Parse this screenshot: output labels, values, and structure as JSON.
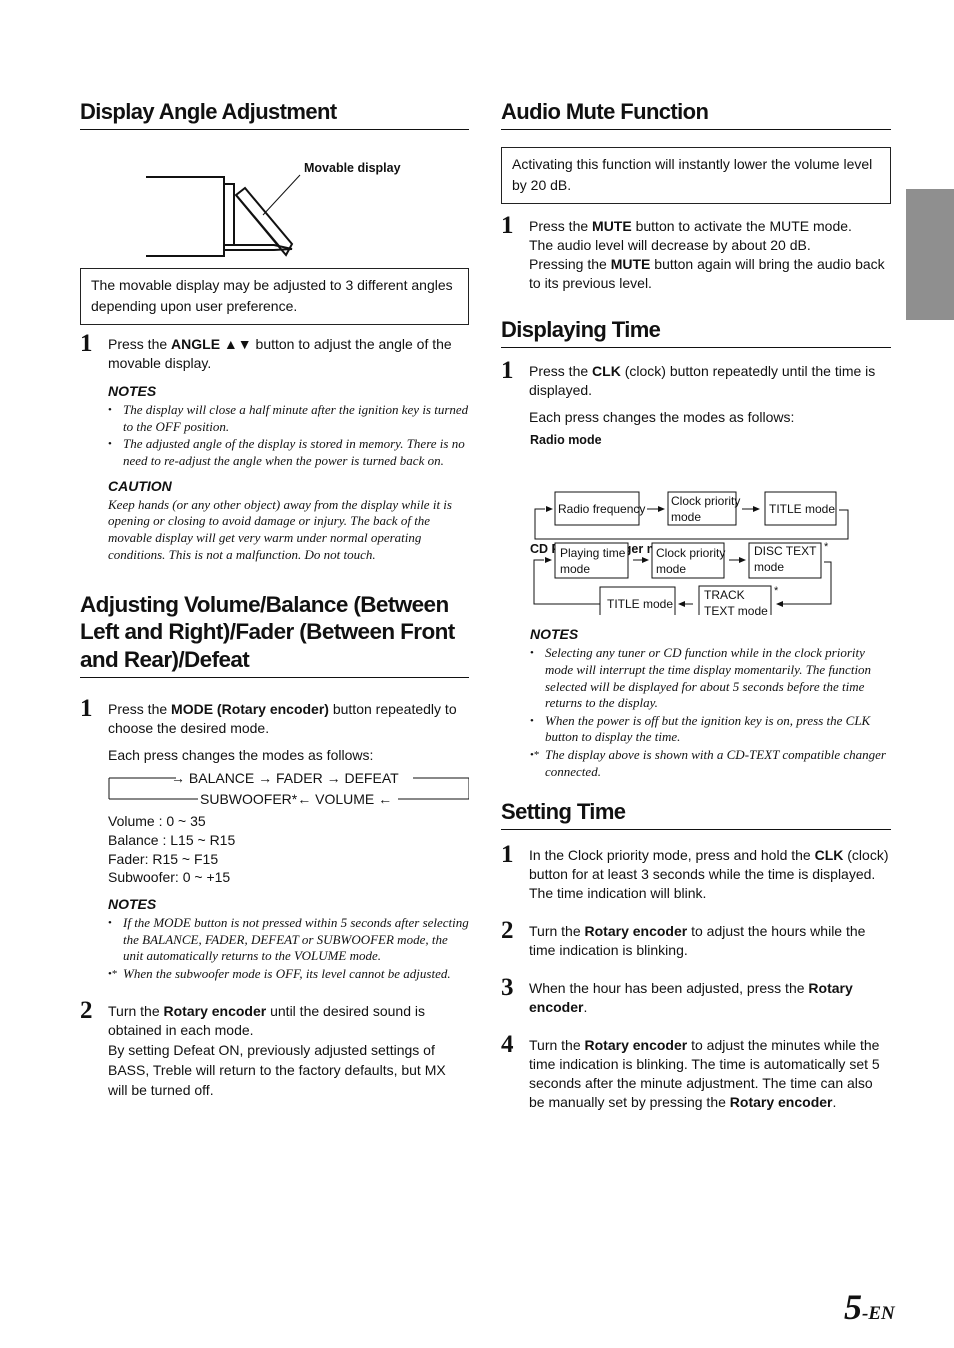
{
  "display_angle": {
    "title": "Display Angle Adjustment",
    "figure_label": "Movable display",
    "intro": "The movable display may be adjusted to 3 different angles depending upon user preference.",
    "step1": {
      "num": "1",
      "pre": "Press the ",
      "bold": "ANGLE ▲▼",
      "post": " button to adjust the angle of the movable display."
    },
    "notes_heading": "NOTES",
    "notes": [
      "The display will close a half minute after the ignition key is turned to the OFF position.",
      "The adjusted angle of the display is stored in memory. There is no need to re-adjust the angle when the power is turned back on."
    ],
    "caution_heading": "CAUTION",
    "caution": "Keep hands (or any other object) away from the display while it is opening or closing to avoid damage or injury. The back of the movable display will get very warm under normal operating conditions. This is not a malfunction. Do not touch."
  },
  "volume": {
    "title": "Adjusting Volume/Balance (Between Left and Right)/Fader (Between Front and Rear)/Defeat",
    "step1": {
      "num": "1",
      "pre": "Press the ",
      "bold": "MODE (Rotary encoder)",
      "post": " button repeatedly to choose the desired mode.",
      "sub": "Each press changes the modes as follows:"
    },
    "flow": {
      "top": "→ BALANCE → FADER → DEFEAT",
      "bottom": "SUBWOOFER*←  VOLUME ←"
    },
    "ranges": [
      "Volume : 0 ~ 35",
      "Balance : L15 ~ R15",
      "Fader:  R15 ~ F15",
      "Subwoofer: 0 ~ +15"
    ],
    "notes_heading": "NOTES",
    "notes": [
      "If the MODE button is not pressed within 5 seconds after selecting the BALANCE, FADER, DEFEAT or SUBWOOFER mode, the unit automatically returns to the VOLUME mode.",
      "When the subwoofer mode is OFF, its level cannot be adjusted."
    ],
    "step2": {
      "num": "2",
      "pre": "Turn the ",
      "bold": "Rotary encoder",
      "post": " until the desired sound is obtained in each mode.",
      "extra": "By setting Defeat ON, previously adjusted settings of BASS, Treble will return to the factory defaults, but MX will be turned off."
    }
  },
  "mute": {
    "title": "Audio Mute Function",
    "intro": "Activating this function will instantly lower the volume level by 20 dB.",
    "step1": {
      "num": "1",
      "l1_pre": "Press the ",
      "l1_bold": "MUTE",
      "l1_post": " button to activate the MUTE mode.",
      "l2": "The audio level will decrease by about 20 dB.",
      "l3_pre": "Pressing the ",
      "l3_bold": "MUTE",
      "l3_post": " button again will bring the audio back to its previous level."
    }
  },
  "displaying_time": {
    "title": "Displaying Time",
    "step1": {
      "num": "1",
      "pre": "Press the ",
      "bold": "CLK",
      "post": " (clock) button repeatedly until the time is displayed.",
      "sub": "Each press changes the modes as follows:"
    },
    "radio_heading": "Radio mode",
    "radio_boxes": [
      "Radio frequency",
      "Clock priority",
      "mode",
      "TITLE mode"
    ],
    "cd_heading": "CD Player/Changer modes",
    "cd_boxes": {
      "playing_1": "Playing time",
      "playing_2": "mode",
      "clock_1": "Clock priority",
      "clock_2": "mode",
      "disc_1": "DISC TEXT",
      "disc_2": "mode",
      "track_1": "TRACK",
      "track_2": "TEXT mode",
      "title": "TITLE mode",
      "asterisk": "*"
    },
    "notes_heading": "NOTES",
    "notes": [
      "Selecting any tuner or CD function while in the clock priority mode will interrupt the time display momentarily. The function selected will be displayed for about 5 seconds before the time returns to the display.",
      "When the power is off but the ignition key is on, press the CLK button to display the time.",
      "The display above is shown with a CD-TEXT compatible changer connected."
    ]
  },
  "setting_time": {
    "title": "Setting Time",
    "steps": [
      {
        "num": "1",
        "pre": "In the Clock priority mode, press and hold the ",
        "bold": "CLK",
        "post": " (clock) button for at least 3 seconds while the time is displayed. The time indication will blink."
      },
      {
        "num": "2",
        "pre": "Turn the ",
        "bold": "Rotary encoder",
        "post": " to adjust the hours while the time indication is blinking."
      },
      {
        "num": "3",
        "pre": "When the hour has been adjusted, press the ",
        "bold": "Rotary encoder",
        "post": "."
      },
      {
        "num": "4",
        "pre": "Turn the ",
        "bold": "Rotary encoder",
        "post": " to adjust the minutes while the time indication is blinking. The time is automatically set 5 seconds after the minute adjustment. The time can also be manually set by pressing the ",
        "bold2": "Rotary encoder",
        "post2": "."
      }
    ]
  },
  "footer": {
    "page_number": "5",
    "suffix": "-EN"
  },
  "colors": {
    "side_tab": "#8f8f8f",
    "text": "#111111"
  }
}
